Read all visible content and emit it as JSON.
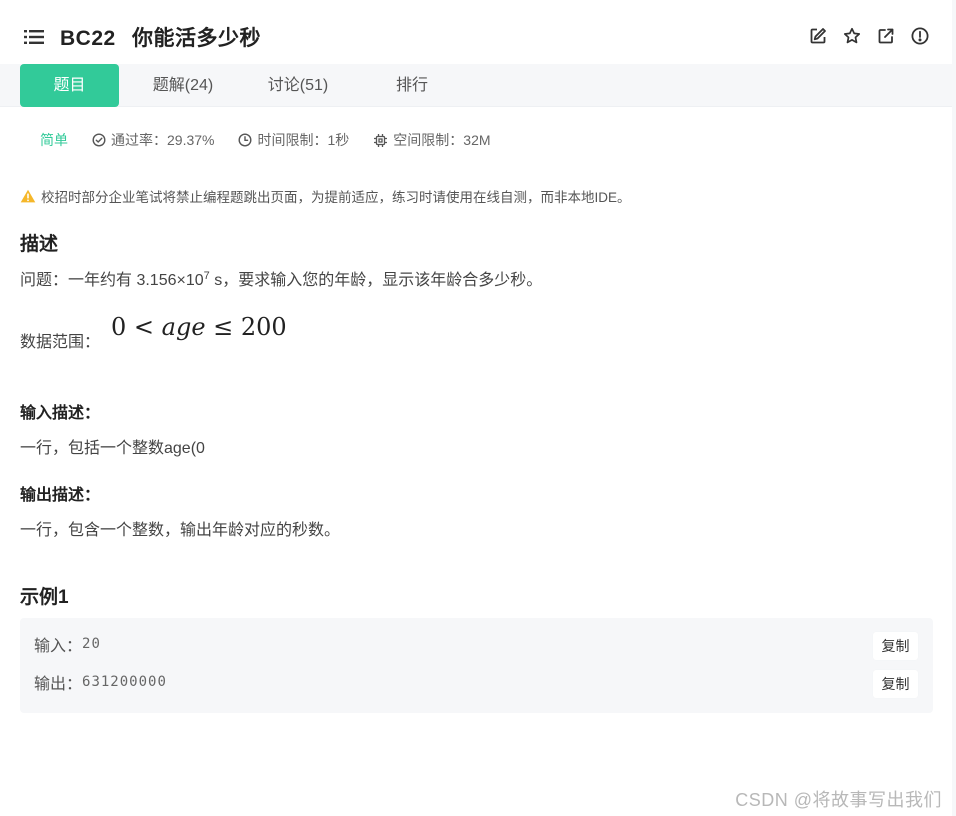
{
  "problem": {
    "code": "BC22",
    "name": "你能活多少秒"
  },
  "tabs": [
    {
      "label": "题目"
    },
    {
      "label": "题解(24)"
    },
    {
      "label": "讨论(51)"
    },
    {
      "label": "排行"
    }
  ],
  "meta": {
    "difficulty": "简单",
    "pass_rate": "通过率：29.37%",
    "time_limit": "时间限制：1秒",
    "memory_limit": "空间限制：32M"
  },
  "notice": "校招时部分企业笔试将禁止编程题跳出页面，为提前适应，练习时请使用在线自测，而非本地IDE。",
  "description": {
    "heading": "描述",
    "question_before": "问题：一年约有 3.156×10",
    "question_exp": "7",
    "question_after": " s，要求输入您的年龄，显示该年龄合多少秒。",
    "range_label": "数据范围：",
    "range_math_a": "0 < ",
    "range_math_var": "age",
    "range_math_b": " ≤ 200"
  },
  "input_desc": {
    "heading": "输入描述：",
    "text": "一行，包括一个整数age(0"
  },
  "output_desc": {
    "heading": "输出描述：",
    "text": "一行，包含一个整数，输出年龄对应的秒数。"
  },
  "example": {
    "heading": "示例1",
    "input_label": "输入：",
    "input_value": "20",
    "output_label": "输出：",
    "output_value": "631200000",
    "copy_label": "复制"
  },
  "watermark": "CSDN @将故事写出我们",
  "colors": {
    "accent": "#32ca99",
    "tab_bg": "#f6f7f9",
    "warning": "#f5b72a"
  },
  "icons": [
    "list-icon",
    "edit-icon",
    "star-icon",
    "external-link-icon",
    "report-icon",
    "check-circle-icon",
    "clock-icon",
    "chip-icon",
    "warning-icon"
  ]
}
